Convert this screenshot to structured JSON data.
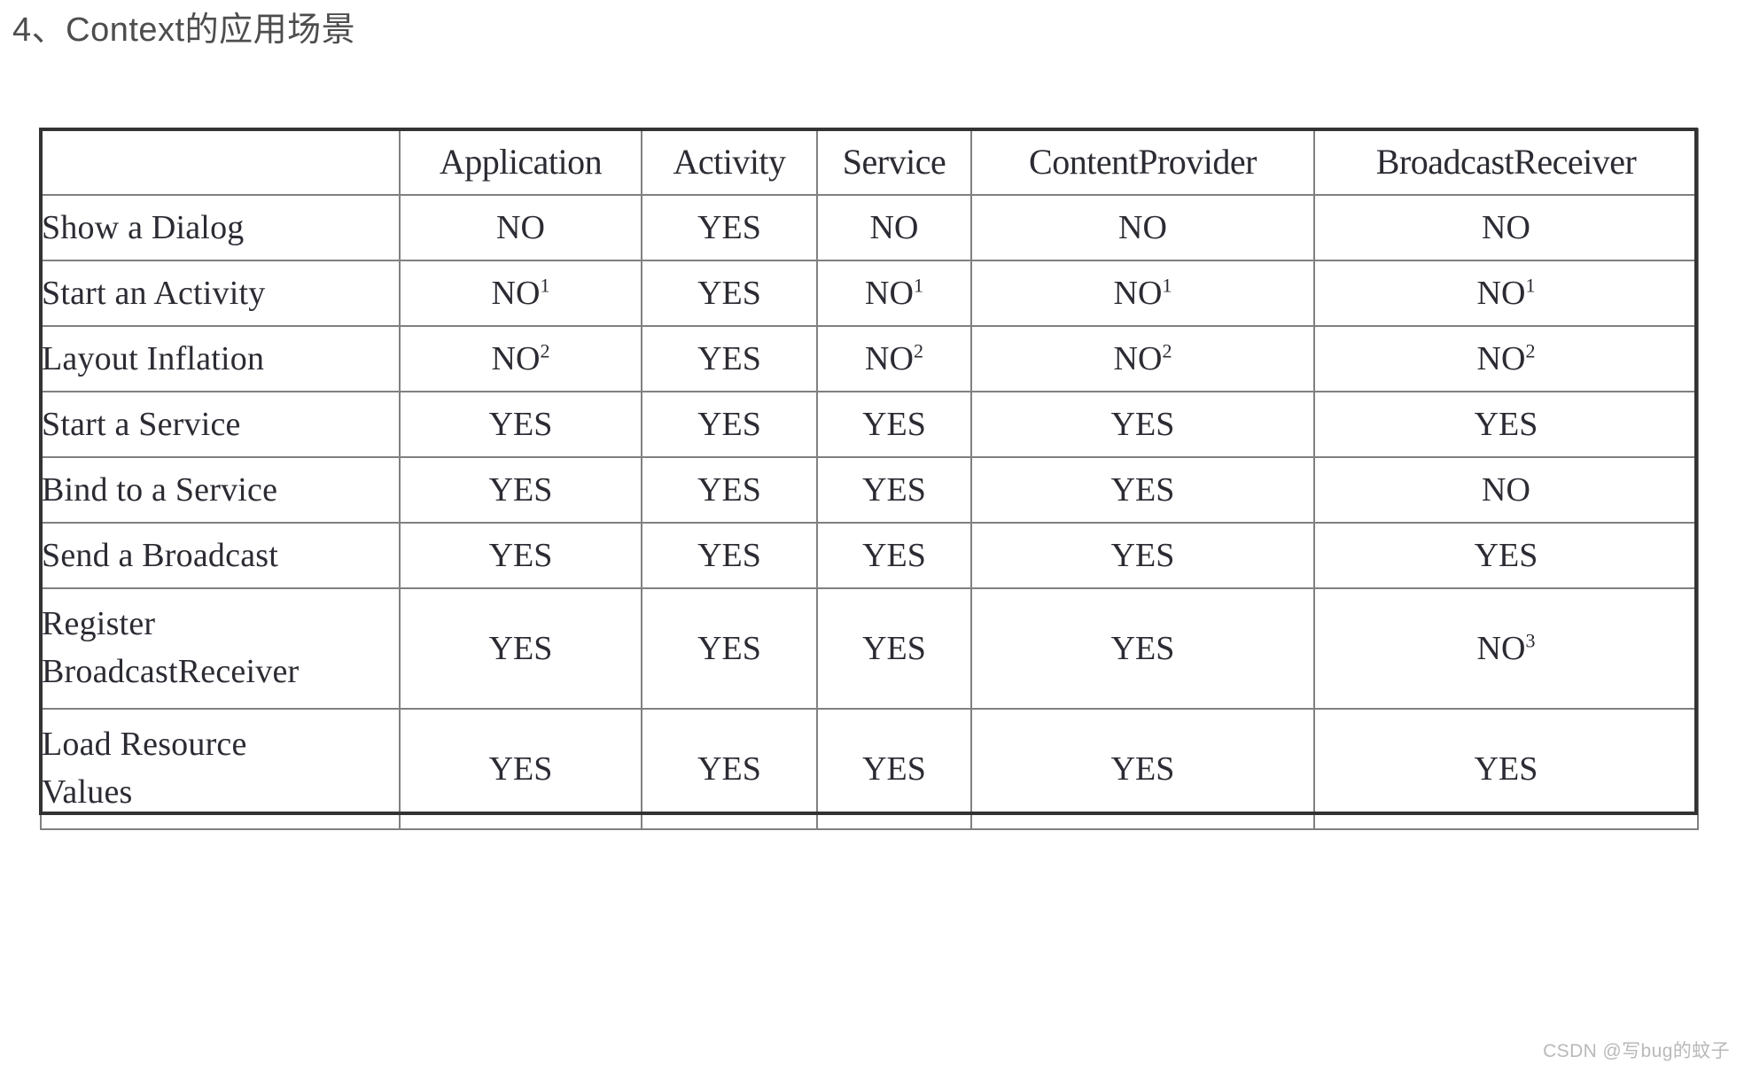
{
  "page": {
    "title": "4、Context的应用场景",
    "title_color": "#4d4d4d",
    "background_color": "#ffffff",
    "watermark": "CSDN @写bug的蚊子",
    "watermark_color": "#b9b9b9"
  },
  "table": {
    "border_color": "#808080",
    "frame_color": "#333333",
    "text_color": "#2b2b33",
    "corner_label": "",
    "columns": [
      "Application",
      "Activity",
      "Service",
      "ContentProvider",
      "BroadcastReceiver"
    ],
    "rows": [
      {
        "label": "Show a Dialog",
        "label_line2": "",
        "tall": false,
        "values": [
          {
            "text": "NO",
            "note": ""
          },
          {
            "text": "YES",
            "note": ""
          },
          {
            "text": "NO",
            "note": ""
          },
          {
            "text": "NO",
            "note": ""
          },
          {
            "text": "NO",
            "note": ""
          }
        ]
      },
      {
        "label": "Start an Activity",
        "label_line2": "",
        "tall": false,
        "values": [
          {
            "text": "NO",
            "note": "1"
          },
          {
            "text": "YES",
            "note": ""
          },
          {
            "text": "NO",
            "note": "1"
          },
          {
            "text": "NO",
            "note": "1"
          },
          {
            "text": "NO",
            "note": "1"
          }
        ]
      },
      {
        "label": "Layout Inflation",
        "label_line2": "",
        "tall": false,
        "values": [
          {
            "text": "NO",
            "note": "2"
          },
          {
            "text": "YES",
            "note": ""
          },
          {
            "text": "NO",
            "note": "2"
          },
          {
            "text": "NO",
            "note": "2"
          },
          {
            "text": "NO",
            "note": "2"
          }
        ]
      },
      {
        "label": "Start a Service",
        "label_line2": "",
        "tall": false,
        "values": [
          {
            "text": "YES",
            "note": ""
          },
          {
            "text": "YES",
            "note": ""
          },
          {
            "text": "YES",
            "note": ""
          },
          {
            "text": "YES",
            "note": ""
          },
          {
            "text": "YES",
            "note": ""
          }
        ]
      },
      {
        "label": "Bind to a Service",
        "label_line2": "",
        "tall": false,
        "values": [
          {
            "text": "YES",
            "note": ""
          },
          {
            "text": "YES",
            "note": ""
          },
          {
            "text": "YES",
            "note": ""
          },
          {
            "text": "YES",
            "note": ""
          },
          {
            "text": "NO",
            "note": ""
          }
        ]
      },
      {
        "label": "Send a Broadcast",
        "label_line2": "",
        "tall": false,
        "values": [
          {
            "text": "YES",
            "note": ""
          },
          {
            "text": "YES",
            "note": ""
          },
          {
            "text": "YES",
            "note": ""
          },
          {
            "text": "YES",
            "note": ""
          },
          {
            "text": "YES",
            "note": ""
          }
        ]
      },
      {
        "label": "Register",
        "label_line2": "BroadcastReceiver",
        "tall": true,
        "values": [
          {
            "text": "YES",
            "note": ""
          },
          {
            "text": "YES",
            "note": ""
          },
          {
            "text": "YES",
            "note": ""
          },
          {
            "text": "YES",
            "note": ""
          },
          {
            "text": "NO",
            "note": "3"
          }
        ]
      },
      {
        "label": "Load Resource",
        "label_line2": "Values",
        "tall": true,
        "values": [
          {
            "text": "YES",
            "note": ""
          },
          {
            "text": "YES",
            "note": ""
          },
          {
            "text": "YES",
            "note": ""
          },
          {
            "text": "YES",
            "note": ""
          },
          {
            "text": "YES",
            "note": ""
          }
        ]
      }
    ]
  }
}
